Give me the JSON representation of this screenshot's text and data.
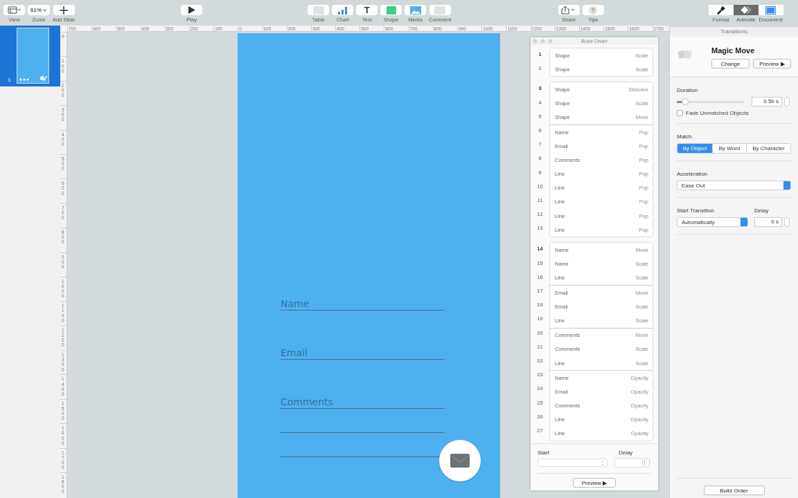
{
  "toolbar": {
    "left": [
      {
        "kind": "view",
        "label": "View"
      },
      {
        "kind": "zoom",
        "label": "Zoom",
        "value": "61%"
      },
      {
        "kind": "add",
        "label": "Add Slide"
      }
    ],
    "play": {
      "label": "Play"
    },
    "insert": [
      {
        "kind": "table",
        "label": "Table"
      },
      {
        "kind": "chart",
        "label": "Chart"
      },
      {
        "kind": "text",
        "label": "Text",
        "glyph": "T"
      },
      {
        "kind": "shape",
        "label": "Shape"
      },
      {
        "kind": "media",
        "label": "Media"
      },
      {
        "kind": "comment",
        "label": "Comment"
      }
    ],
    "share": [
      {
        "kind": "share",
        "label": "Share"
      },
      {
        "kind": "tips",
        "label": "Tips",
        "glyph": "?"
      }
    ],
    "inspector_tabs": [
      {
        "kind": "format",
        "label": "Format",
        "selected": false
      },
      {
        "kind": "animate",
        "label": "Animate",
        "selected": true
      },
      {
        "kind": "document",
        "label": "Document",
        "selected": false
      }
    ]
  },
  "navigator": {
    "slides": [
      {
        "number": "1",
        "selected": true
      }
    ]
  },
  "rulers": {
    "horizontal": [
      "700",
      "600",
      "500",
      "400",
      "300",
      "200",
      "100",
      "0",
      "100",
      "200",
      "300",
      "400",
      "500",
      "600",
      "700",
      "800",
      "900",
      "1000",
      "1100",
      "1200",
      "1300",
      "1400",
      "1500",
      "1600",
      "1700"
    ],
    "vertical": [
      "0",
      "100",
      "200",
      "300",
      "400",
      "500",
      "600",
      "700",
      "800",
      "900",
      "1000",
      "1100",
      "1200",
      "1300",
      "1400",
      "1500",
      "1600",
      "1700",
      "1800"
    ]
  },
  "slide": {
    "fields": [
      {
        "placeholder": "Name"
      },
      {
        "placeholder": "Email"
      },
      {
        "placeholder": "Comments"
      }
    ]
  },
  "build_order": {
    "title": "Build Order",
    "boxes": [
      {
        "sections": [
          [
            {
              "number": "1",
              "object": "Shape",
              "effect": "Scale"
            },
            {
              "number": "2",
              "object": "Shape",
              "effect": "Scale"
            }
          ]
        ]
      },
      {
        "sections": [
          [
            {
              "number": "3",
              "object": "Shape",
              "effect": "Dissolve"
            },
            {
              "number": "4",
              "object": "Shape",
              "effect": "Scale"
            },
            {
              "number": "5",
              "object": "Shape",
              "effect": "Move"
            }
          ],
          [
            {
              "number": "6",
              "object": "Name",
              "effect": "Pop"
            },
            {
              "number": "7",
              "object": "Email",
              "effect": "Pop"
            },
            {
              "number": "8",
              "object": "Comments",
              "effect": "Pop"
            },
            {
              "number": "9",
              "object": "Line",
              "effect": "Pop"
            },
            {
              "number": "10",
              "object": "Line",
              "effect": "Pop"
            },
            {
              "number": "11",
              "object": "Line",
              "effect": "Pop"
            },
            {
              "number": "12",
              "object": "Line",
              "effect": "Pop"
            },
            {
              "number": "13",
              "object": "Line",
              "effect": "Pop"
            }
          ]
        ]
      },
      {
        "sections": [
          [
            {
              "number": "14",
              "object": "Name",
              "effect": "Move"
            },
            {
              "number": "15",
              "object": "Name",
              "effect": "Scale"
            },
            {
              "number": "16",
              "object": "Line",
              "effect": "Scale"
            }
          ],
          [
            {
              "number": "17",
              "object": "Email",
              "effect": "Move"
            },
            {
              "number": "18",
              "object": "Email",
              "effect": "Scale"
            },
            {
              "number": "19",
              "object": "Line",
              "effect": "Scale"
            }
          ],
          [
            {
              "number": "20",
              "object": "Comments",
              "effect": "Move"
            },
            {
              "number": "21",
              "object": "Comments",
              "effect": "Scale"
            },
            {
              "number": "22",
              "object": "Line",
              "effect": "Scale"
            }
          ],
          [
            {
              "number": "23",
              "object": "Name",
              "effect": "Opacity"
            },
            {
              "number": "24",
              "object": "Email",
              "effect": "Opacity"
            },
            {
              "number": "25",
              "object": "Comments",
              "effect": "Opacity"
            },
            {
              "number": "26",
              "object": "Line",
              "effect": "Opacity"
            },
            {
              "number": "27",
              "object": "Line",
              "effect": "Opacity"
            }
          ]
        ]
      }
    ],
    "start_label": "Start",
    "delay_label": "Delay",
    "preview": "Preview ▶"
  },
  "inspector": {
    "header": "Transitions",
    "effect": "Magic Move",
    "change": "Change",
    "preview": "Preview ▶",
    "duration": {
      "label": "Duration",
      "level": 0.12,
      "value": "0.50 s"
    },
    "fade": {
      "label": "Fade Unmatched Objects",
      "checked": false
    },
    "match": {
      "label": "Match",
      "options": [
        {
          "label": "By Object",
          "selected": true
        },
        {
          "label": "By Word",
          "selected": false
        },
        {
          "label": "By Character",
          "selected": false
        }
      ]
    },
    "acceleration": {
      "label": "Acceleration",
      "value": "Ease Out"
    },
    "start": {
      "label": "Start Transition",
      "value": "Automatically"
    },
    "delay": {
      "label": "Delay",
      "value": "0 s"
    },
    "build_order_button": "Build Order"
  }
}
